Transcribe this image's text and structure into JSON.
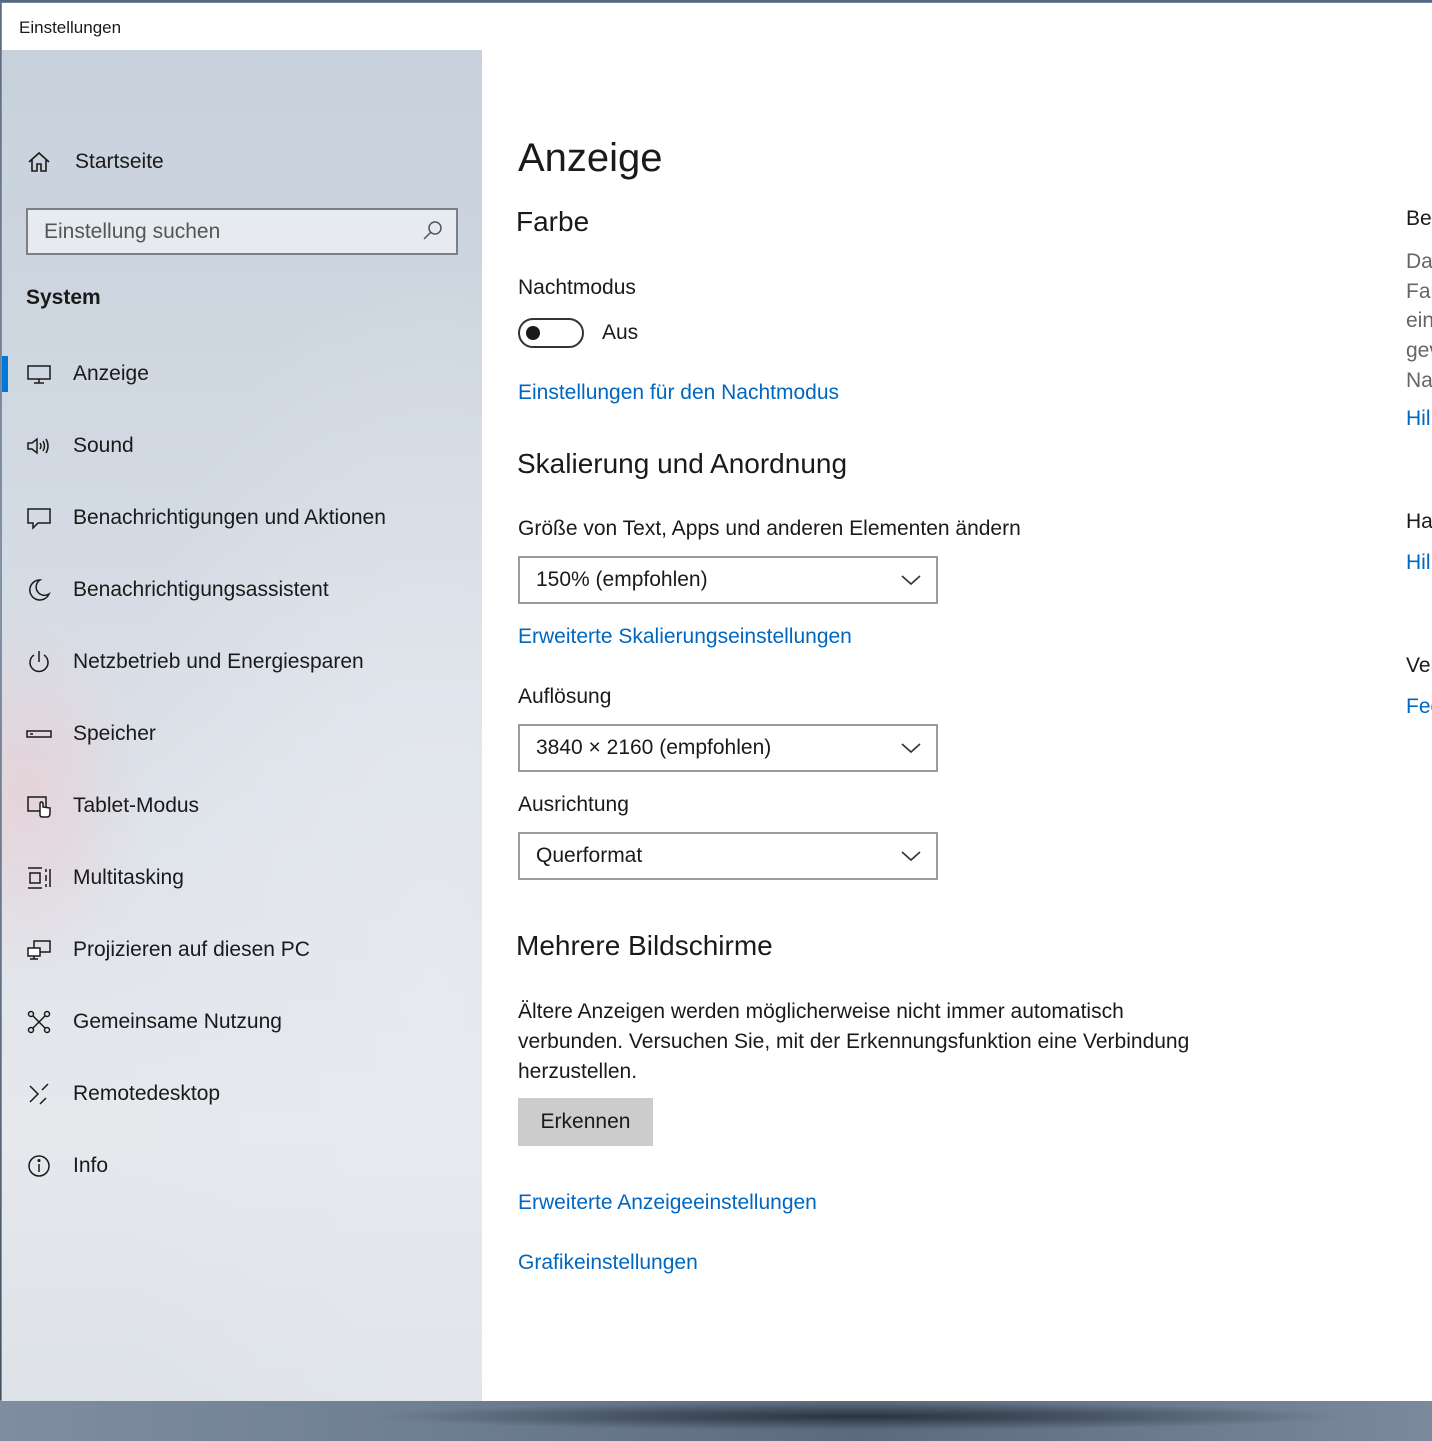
{
  "window": {
    "title": "Einstellungen"
  },
  "sidebar": {
    "home_label": "Startseite",
    "search_placeholder": "Einstellung suchen",
    "section": "System",
    "items": [
      {
        "label": "Anzeige",
        "icon": "monitor-icon",
        "active": true
      },
      {
        "label": "Sound",
        "icon": "speaker-icon"
      },
      {
        "label": "Benachrichtigungen und Aktionen",
        "icon": "message-icon"
      },
      {
        "label": "Benachrichtigungsassistent",
        "icon": "moon-icon"
      },
      {
        "label": "Netzbetrieb und Energiesparen",
        "icon": "power-icon"
      },
      {
        "label": "Speicher",
        "icon": "storage-icon"
      },
      {
        "label": "Tablet-Modus",
        "icon": "tablet-icon"
      },
      {
        "label": "Multitasking",
        "icon": "multitasking-icon"
      },
      {
        "label": "Projizieren auf diesen PC",
        "icon": "project-icon"
      },
      {
        "label": "Gemeinsame Nutzung",
        "icon": "share-icon"
      },
      {
        "label": "Remotedesktop",
        "icon": "remote-desktop-icon"
      },
      {
        "label": "Info",
        "icon": "info-icon"
      }
    ]
  },
  "main": {
    "title": "Anzeige",
    "color": {
      "heading": "Farbe",
      "night_label": "Nachtmodus",
      "toggle_state": "Aus",
      "night_settings_link": "Einstellungen für den Nachtmodus"
    },
    "scale": {
      "heading": "Skalierung und Anordnung",
      "size_label": "Größe von Text, Apps und anderen Elementen ändern",
      "size_value": "150% (empfohlen)",
      "advanced_link": "Erweiterte Skalierungseinstellungen",
      "resolution_label": "Auflösung",
      "resolution_value": "3840 × 2160 (empfohlen)",
      "orientation_label": "Ausrichtung",
      "orientation_value": "Querformat"
    },
    "multi": {
      "heading": "Mehrere Bildschirme",
      "description": "Ältere Anzeigen werden möglicherweise nicht immer automatisch verbunden. Versuchen Sie, mit der Erkennungsfunktion eine Verbindung herzustellen.",
      "detect_button": "Erkennen",
      "advanced_display_link": "Erweiterte Anzeigeeinstellungen",
      "graphics_link": "Grafikeinstellungen"
    }
  },
  "right": {
    "h1": "Bes",
    "lines": [
      "Da",
      "Far",
      "ein",
      "gev",
      "Na"
    ],
    "link1": "Hil",
    "h2": "Ha",
    "link2": "Hil",
    "h3": "Ver",
    "link3": "Fee"
  },
  "colors": {
    "accent": "#0078d7",
    "link": "#0067c0"
  }
}
